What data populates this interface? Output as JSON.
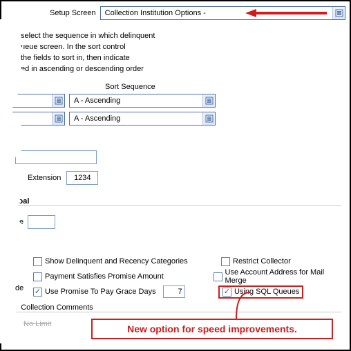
{
  "header": {
    "label": "Setup Screen",
    "combo_value": "Collection Institution Options -"
  },
  "description": {
    "line1": "select the sequence in which delinquent",
    "line2": "ueue screen.  In the sort control",
    "line3": "the fields to sort in, then indicate",
    "line4": "ed in ascending or descending order"
  },
  "sort": {
    "title": "Sort Sequence",
    "row1": "A - Ascending",
    "row2": "A - Ascending"
  },
  "extension": {
    "label": "Extension",
    "value": "1234"
  },
  "goal": {
    "title": "Goal",
    "prefix": "e"
  },
  "checks": {
    "show_delinq": "Show Delinquent and Recency Categories",
    "restrict": "Restrict Collector",
    "pay_sat": "Payment Satisfies Promise Amount",
    "mail_merge": "Use Account Address for Mail Merge",
    "grace": "Use Promise To Pay Grace Days",
    "grace_value": "7",
    "sql": "Using SQL Queues",
    "row3_prefix": "de"
  },
  "comments": {
    "label": "to Collection Comments",
    "nolimit": "No Limit"
  },
  "callout": {
    "text": "New option for speed improvements."
  }
}
